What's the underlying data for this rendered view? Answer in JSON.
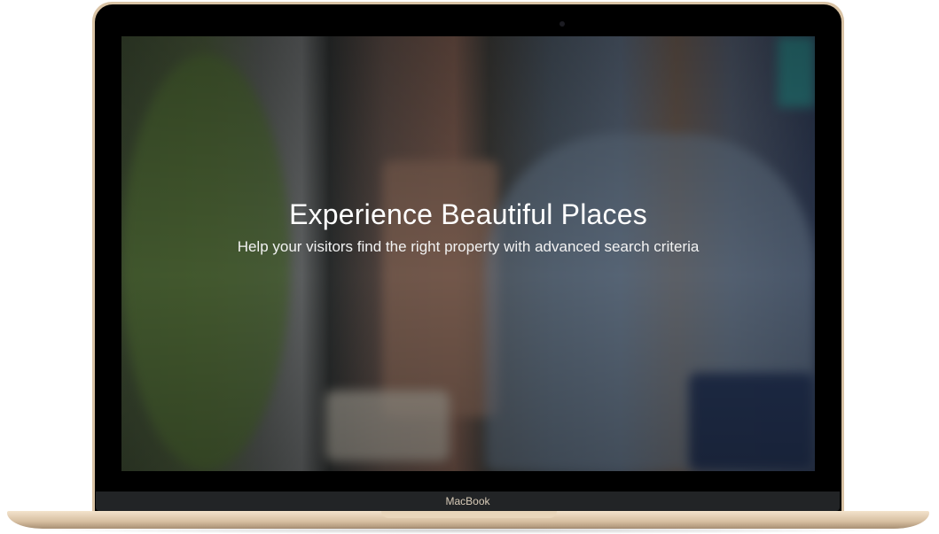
{
  "hero": {
    "title": "Experience Beautiful Places",
    "subtitle": "Help your visitors find the right property with advanced search criteria"
  },
  "device": {
    "brand_label": "MacBook"
  }
}
